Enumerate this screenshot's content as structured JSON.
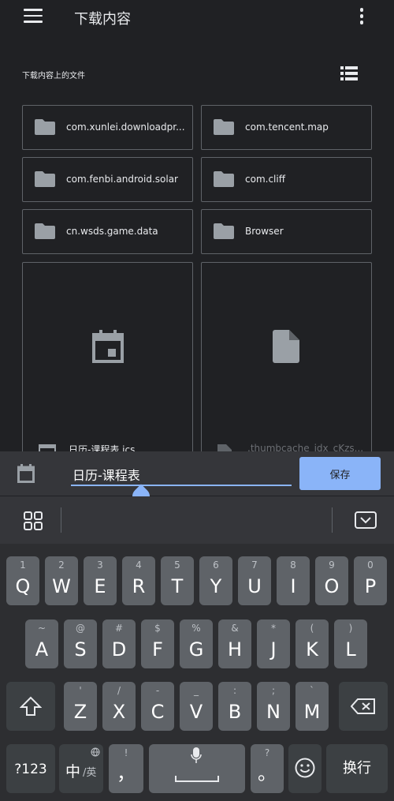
{
  "header": {
    "title": "下载内容"
  },
  "section": {
    "label": "下载内容上的文件"
  },
  "folders": [
    {
      "name": "com.xunlei.downloadpr..."
    },
    {
      "name": "com.tencent.map"
    },
    {
      "name": "com.fenbi.android.solar"
    },
    {
      "name": "com.cliff"
    },
    {
      "name": "cn.wsds.game.data"
    },
    {
      "name": "Browser"
    }
  ],
  "files": [
    {
      "name": "日历-课程表.ics",
      "icon": "calendar-icon"
    },
    {
      "name": ".thumbcache_idx_cKzs...",
      "icon": "file-icon"
    }
  ],
  "rename": {
    "value": "日历-课程表",
    "save_label": "保存"
  },
  "keyboard": {
    "row1": [
      {
        "main": "Q",
        "sub": "1"
      },
      {
        "main": "W",
        "sub": "2"
      },
      {
        "main": "E",
        "sub": "3"
      },
      {
        "main": "R",
        "sub": "4"
      },
      {
        "main": "T",
        "sub": "5"
      },
      {
        "main": "Y",
        "sub": "6"
      },
      {
        "main": "U",
        "sub": "7"
      },
      {
        "main": "I",
        "sub": "8"
      },
      {
        "main": "O",
        "sub": "9"
      },
      {
        "main": "P",
        "sub": "0"
      }
    ],
    "row2": [
      {
        "main": "A",
        "sub": "~"
      },
      {
        "main": "S",
        "sub": "@"
      },
      {
        "main": "D",
        "sub": "#"
      },
      {
        "main": "F",
        "sub": "$"
      },
      {
        "main": "G",
        "sub": "%"
      },
      {
        "main": "H",
        "sub": "&"
      },
      {
        "main": "J",
        "sub": "*"
      },
      {
        "main": "K",
        "sub": "("
      },
      {
        "main": "L",
        "sub": ")"
      }
    ],
    "row3": [
      {
        "main": "Z",
        "sub": "'"
      },
      {
        "main": "X",
        "sub": "/"
      },
      {
        "main": "C",
        "sub": "-"
      },
      {
        "main": "V",
        "sub": "_"
      },
      {
        "main": "B",
        "sub": ":"
      },
      {
        "main": "N",
        "sub": ";"
      },
      {
        "main": "M",
        "sub": "`"
      }
    ],
    "numbers_label": "?123",
    "lang_main": "中",
    "lang_alt": "/英",
    "comma": "，",
    "comma_sub": "!",
    "period": "。",
    "period_sub": "?",
    "enter_label": "换行"
  },
  "colors": {
    "background": "#202124",
    "accent": "#8ab4f8",
    "key": "#5f6368",
    "key_dark": "#3c4043"
  }
}
